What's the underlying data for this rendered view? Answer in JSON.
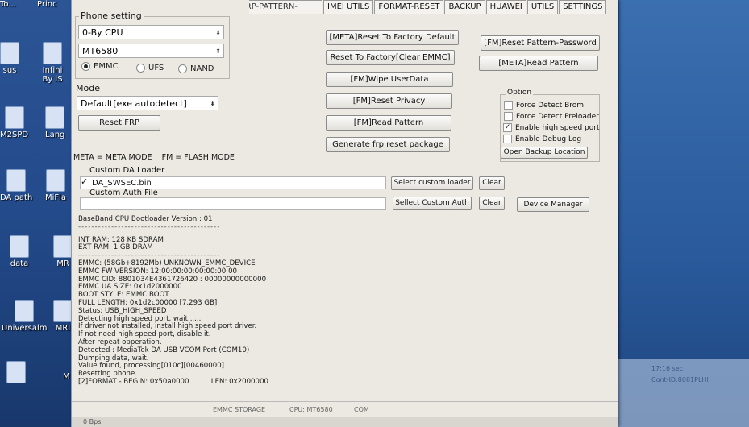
{
  "desktop": {
    "icons": [
      {
        "label": "To...",
        "extra": "Princ"
      },
      {
        "label": "sus",
        "extra": "Infini By iS"
      },
      {
        "label": "M2SPD",
        "extra": "Lang"
      },
      {
        "label": "DA path",
        "extra": "MiFla"
      },
      {
        "label": "data",
        "extra": "MR"
      },
      {
        "label": "Universalm",
        "extra": "MRI"
      },
      {
        "label": "",
        "extra": "M"
      }
    ],
    "notify": {
      "time": "17:16 sec",
      "name": "Cont-ID:8081PLHI"
    }
  },
  "tabs": [
    "FRP-PATTERN-PRIVACY",
    "IMEI UTILS",
    "FORMAT-RESET",
    "BACKUP",
    "HUAWEI",
    "UTILS",
    "SETTINGS"
  ],
  "phone": {
    "title": "Phone setting",
    "cpu_select": "0-By CPU",
    "chip_select": "MT6580",
    "storage": [
      {
        "label": "EMMC",
        "checked": true
      },
      {
        "label": "UFS",
        "checked": false
      },
      {
        "label": "NAND",
        "checked": false
      }
    ]
  },
  "mode": {
    "title": "Mode",
    "select": "Default[exe autodetect]",
    "reset_frp": "Reset FRP"
  },
  "center_buttons": [
    "[META]Reset To Factory Default",
    "Reset To Factory[Clear EMMC]",
    "[FM]Wipe UserData",
    "[FM]Reset Privacy",
    "[FM]Read Pattern",
    "Generate frp reset package"
  ],
  "right_buttons": [
    "[FM]Reset Pattern-Password",
    "[META]Read Pattern"
  ],
  "option": {
    "title": "Option",
    "items": [
      {
        "label": "Force Detect Brom",
        "checked": false
      },
      {
        "label": "Force Detect Preloader",
        "checked": false
      },
      {
        "label": "Enable high speed port",
        "checked": true
      },
      {
        "label": "Enable Debug Log",
        "checked": false
      }
    ],
    "open_backup": "Open Backup Location"
  },
  "legend": "META = META MODE    FM = FLASH MODE",
  "custom_da": {
    "title": "Custom DA Loader",
    "value": "DA_SWSEC.bin",
    "select_btn": "Select custom loader",
    "clear_btn": "Clear"
  },
  "custom_auth": {
    "title": "Custom Auth File",
    "value": "",
    "select_btn": "Sellect Custom Auth",
    "clear_btn": "Clear",
    "device_manager": "Device Manager"
  },
  "log": [
    "BaseBand CPU Bootloader Version : 01",
    "-------------------------------------------",
    "INT RAM: 128 KB SDRAM",
    "EXT RAM: 1 GB  DRAM",
    "-------------------------------------------",
    "EMMC: (58Gb+8192Mb) UNKNOWN_EMMC_DEVICE",
    "EMMC FW VERSION: 12:00:00:00:00:00:00:00",
    "EMMC CID: 8801034E4361726420 : 00000000000000",
    "EMMC UA SIZE: 0x1d2000000",
    "BOOT STYLE: EMMC BOOT",
    "FULL LENGTH: 0x1d2c00000    [7.293 GB]",
    "Status: USB_HIGH_SPEED",
    "Detecting high speed port, wait......",
    "If driver not installed, install high speed port driver.",
    "If not need high speed port, disable it.",
    "After repeat opperation.",
    "Detected : MediaTek DA USB VCOM Port (COM10)",
    "Dumping data, wait.",
    "Value found, processing[010c][00460000]",
    "Resetting phone.",
    "[2]FORMAT - BEGIN: 0x50a0000          LEN: 0x2000000"
  ],
  "status": {
    "storage": "EMMC STORAGE",
    "cpu": "CPU: MT6580",
    "port": "COM",
    "left": "0 Bps"
  }
}
